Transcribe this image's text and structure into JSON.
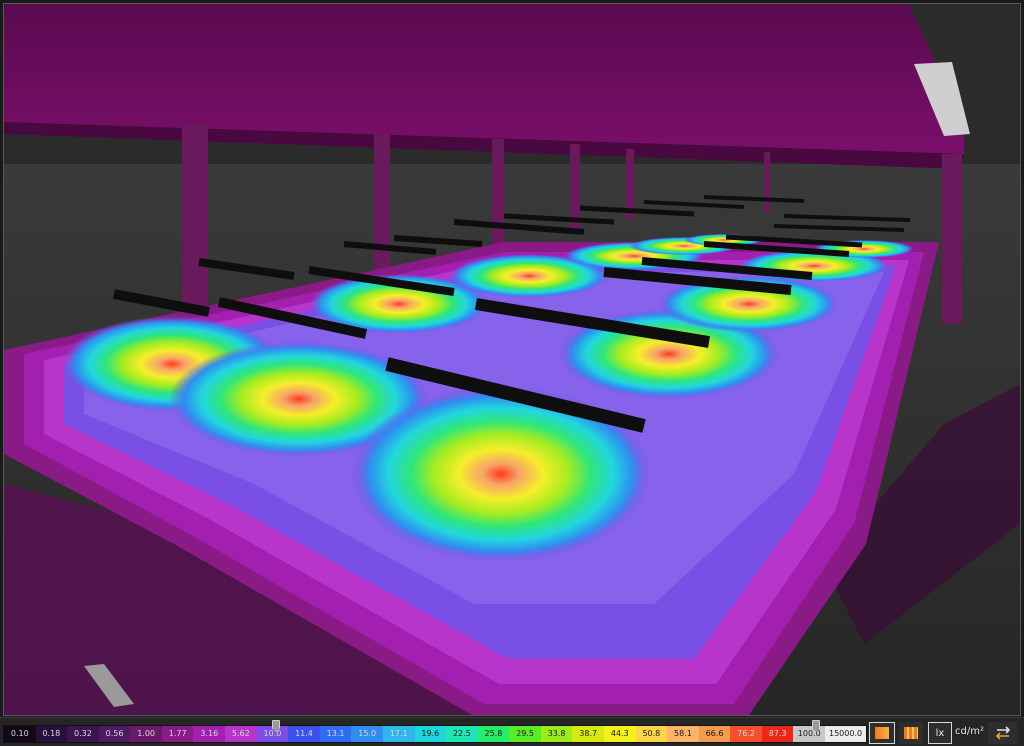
{
  "legend": {
    "values": [
      "0.10",
      "0.18",
      "0.32",
      "0.56",
      "1.00",
      "1.77",
      "3.16",
      "5.62",
      "10.0",
      "11.4",
      "13.1",
      "15.0",
      "17.1",
      "19.6",
      "22.5",
      "25.8",
      "29.5",
      "33.8",
      "38.7",
      "44.3",
      "50.8",
      "58.1",
      "66.6",
      "76.2",
      "87.3",
      "100.0",
      "15000.0"
    ],
    "colors": [
      "#120818",
      "#2a0f3c",
      "#3c1450",
      "#4e1a63",
      "#6a1a68",
      "#8a1a86",
      "#a31fb0",
      "#b835cc",
      "#7a4fe6",
      "#3b52ee",
      "#2f6cf4",
      "#2f8ef0",
      "#2fb6ec",
      "#1fd6df",
      "#1fe6b6",
      "#27ec6c",
      "#59ec27",
      "#9cec1d",
      "#d8ea13",
      "#f4f019",
      "#fbd44a",
      "#fbb36a",
      "#f59a4e",
      "#f2512c",
      "#ec2718",
      "#c8c8c8",
      "#ececec"
    ],
    "lower_handle_value": "10.0",
    "upper_handle_value": "100.0"
  },
  "toolbar": {
    "unit_lux": "lx",
    "unit_luminance": "cd/m²"
  },
  "icons": {
    "false_color_solid": "false-color-solid-icon",
    "false_color_gradient": "false-color-gradient-icon",
    "swap": "swap-arrows-icon"
  }
}
